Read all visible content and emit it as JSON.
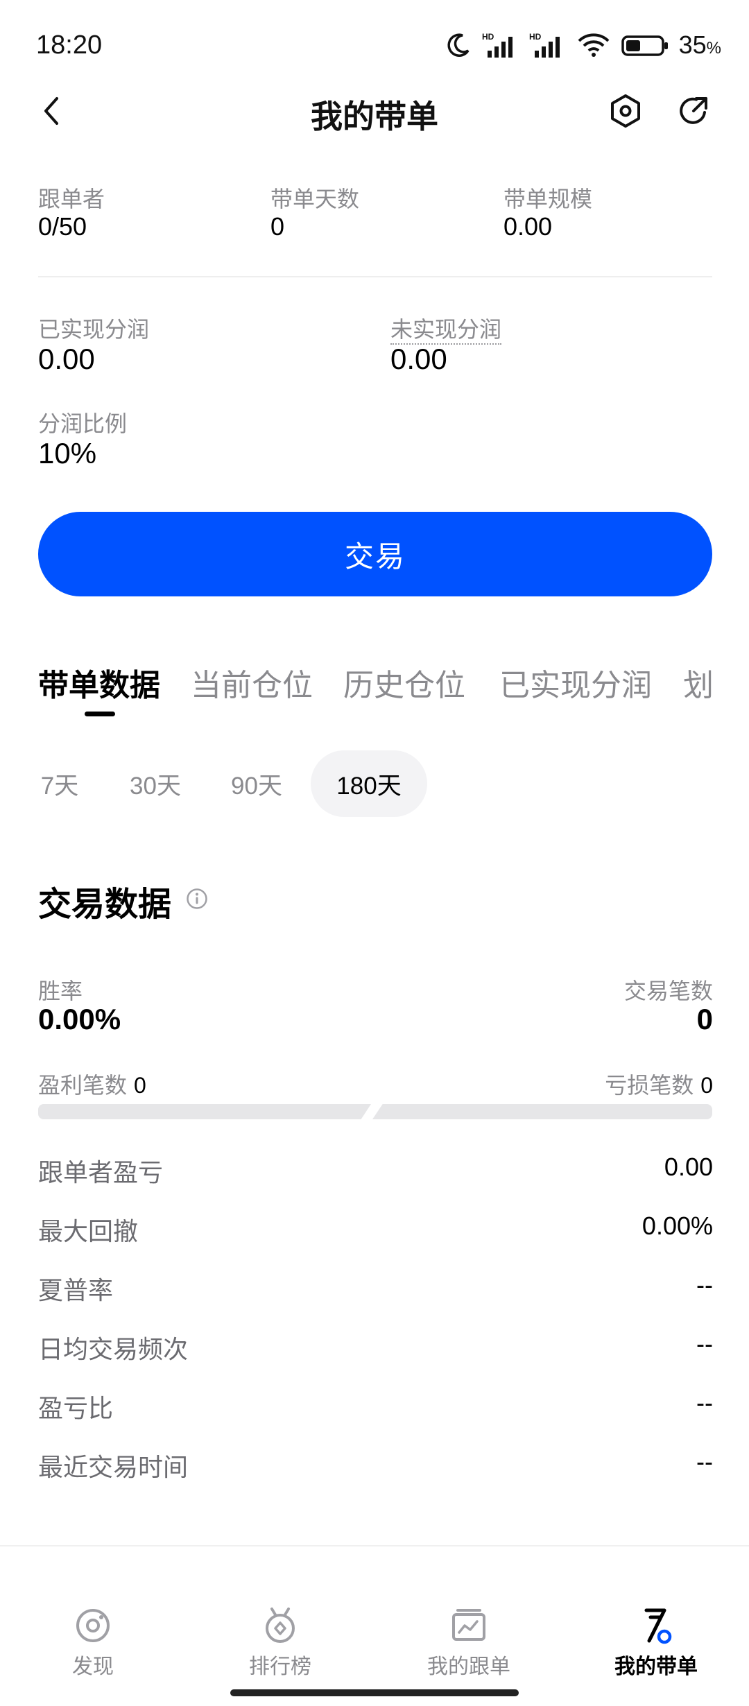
{
  "status_bar": {
    "time": "18:20",
    "battery": "35",
    "battery_unit": "%",
    "icons": [
      "moon-icon",
      "hd-signal-icon",
      "hd-signal-icon",
      "wifi-icon",
      "battery-icon"
    ]
  },
  "header": {
    "title": "我的带单",
    "back_icon": "chevron-left-icon",
    "settings_icon": "hexagon-settings-icon",
    "share_icon": "share-arrow-icon"
  },
  "stats": {
    "followers_label": "跟单者",
    "followers_value": "0/50",
    "days_label": "带单天数",
    "days_value": "0",
    "scale_label": "带单规模",
    "scale_value": "0.00",
    "realized_label": "已实现分润",
    "realized_value": "0.00",
    "unrealized_label": "未实现分润",
    "unrealized_value": "0.00",
    "ratio_label": "分润比例",
    "ratio_value": "10%"
  },
  "trade_button": "交易",
  "tabs": [
    {
      "label": "带单数据",
      "active": true
    },
    {
      "label": "当前仓位",
      "active": false
    },
    {
      "label": "历史仓位",
      "active": false
    },
    {
      "label": "已实现分润",
      "active": false
    },
    {
      "label": "划",
      "active": false
    }
  ],
  "periods": [
    {
      "label": "7天",
      "active": false
    },
    {
      "label": "30天",
      "active": false
    },
    {
      "label": "90天",
      "active": false
    },
    {
      "label": "180天",
      "active": true
    }
  ],
  "trade_data": {
    "title": "交易数据",
    "win_rate_label": "胜率",
    "win_rate_value": "0.00%",
    "trade_count_label": "交易笔数",
    "trade_count_value": "0",
    "profit_count_label": "盈利笔数",
    "profit_count_value": "0",
    "loss_count_label": "亏损笔数",
    "loss_count_value": "0",
    "rows": [
      {
        "label": "跟单者盈亏",
        "value": "0.00"
      },
      {
        "label": "最大回撤",
        "value": "0.00%"
      },
      {
        "label": "夏普率",
        "value": "--"
      },
      {
        "label": "日均交易频次",
        "value": "--"
      },
      {
        "label": "盈亏比",
        "value": "--"
      },
      {
        "label": "最近交易时间",
        "value": "--"
      }
    ]
  },
  "bottom_nav": [
    {
      "label": "发现",
      "icon": "discover-icon",
      "active": false
    },
    {
      "label": "排行榜",
      "icon": "medal-icon",
      "active": false
    },
    {
      "label": "我的跟单",
      "icon": "copy-trade-icon",
      "active": false
    },
    {
      "label": "我的带单",
      "icon": "lead-trade-icon",
      "active": true
    }
  ],
  "colors": {
    "accent": "#0052ff",
    "text_primary": "#000000",
    "text_secondary": "#8a8a8e",
    "bar_neutral": "#e6e6e8"
  }
}
